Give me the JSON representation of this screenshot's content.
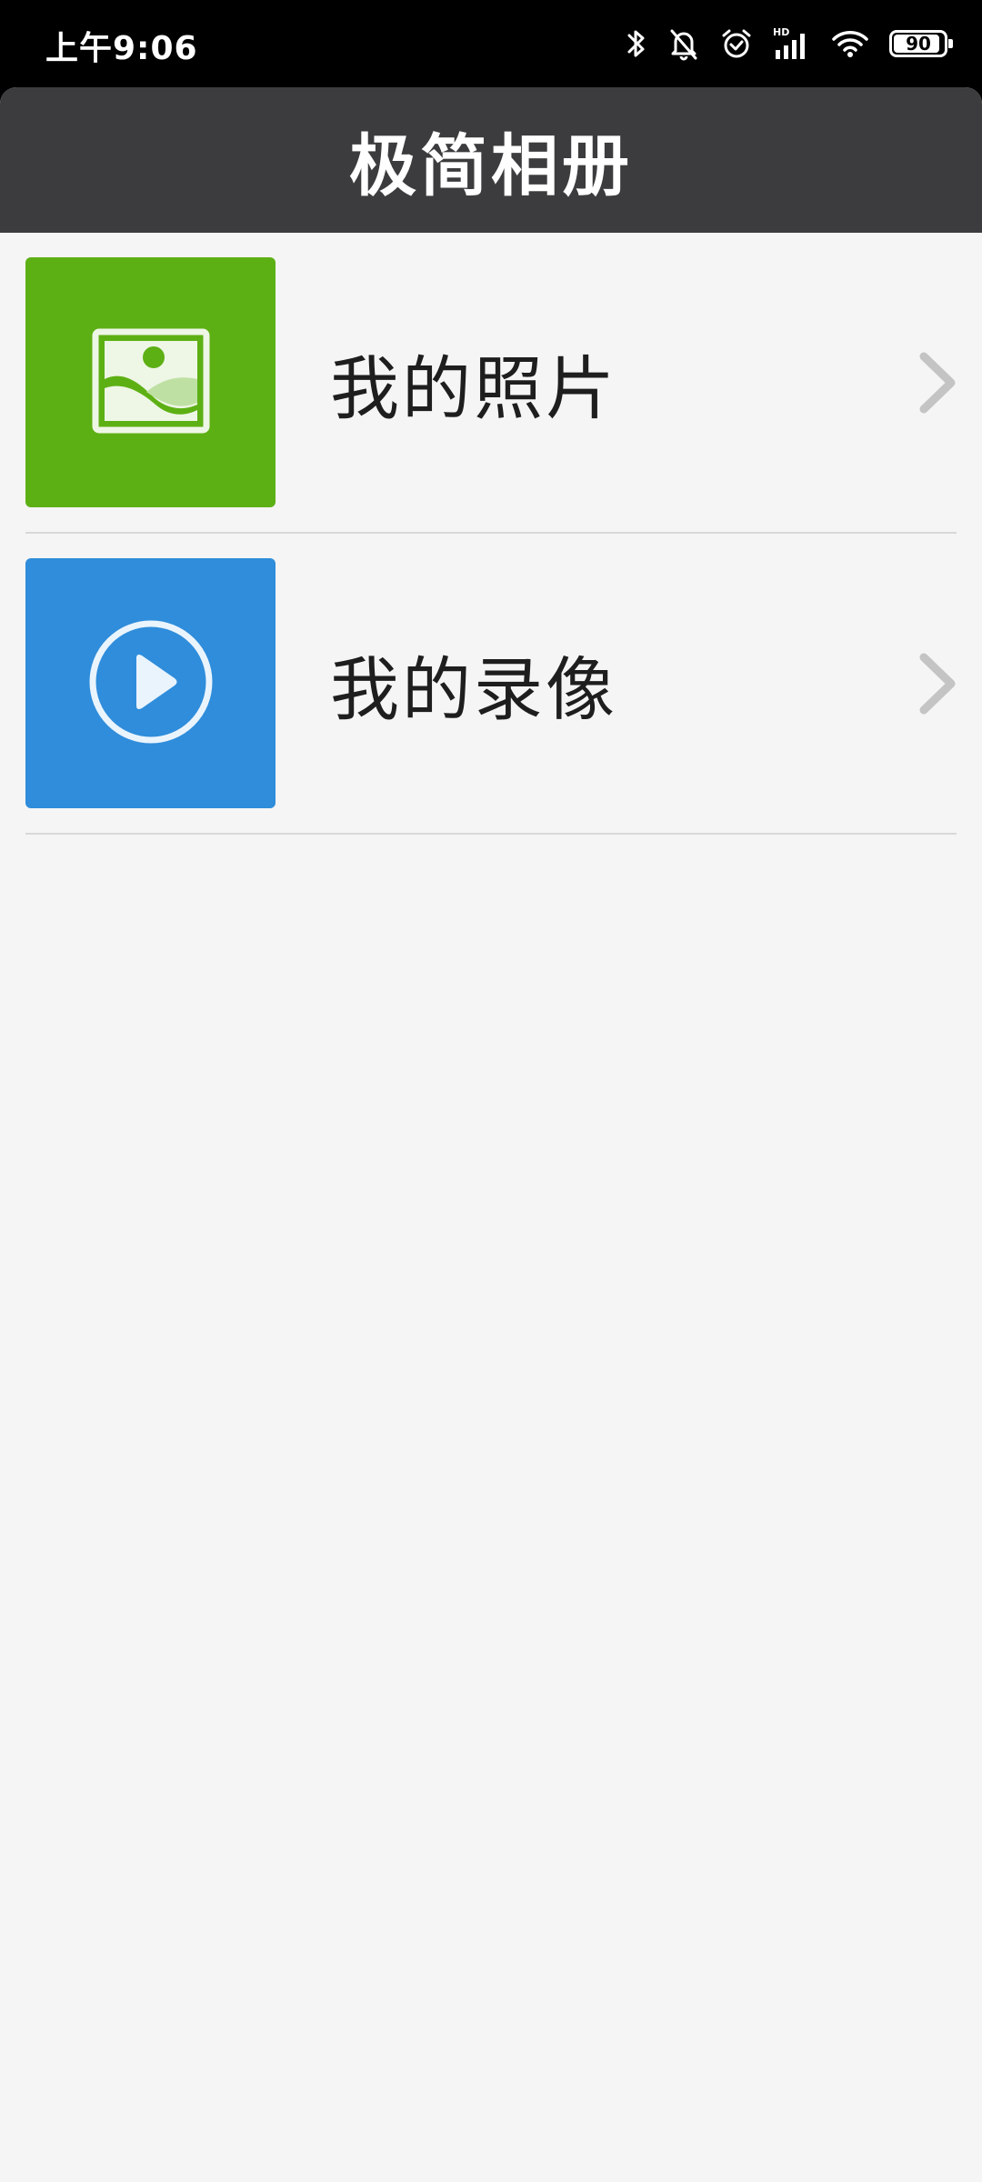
{
  "status_bar": {
    "time": "上午9:06",
    "battery_level": "90",
    "icons": [
      "bluetooth-icon",
      "bell-muted-icon",
      "alarm-icon",
      "hd-signal-icon",
      "wifi-icon",
      "battery-icon"
    ]
  },
  "header": {
    "title": "极简相册"
  },
  "menu": {
    "items": [
      {
        "label": "我的照片",
        "icon": "image-icon",
        "tile_color": "#5db014"
      },
      {
        "label": "我的录像",
        "icon": "play-circle-icon",
        "tile_color": "#2f8ddb"
      }
    ]
  },
  "colors": {
    "header_bg": "#3c3c3e",
    "page_bg": "#f5f5f5",
    "chevron": "#c4c4c4",
    "divider": "#d8d8d8"
  }
}
